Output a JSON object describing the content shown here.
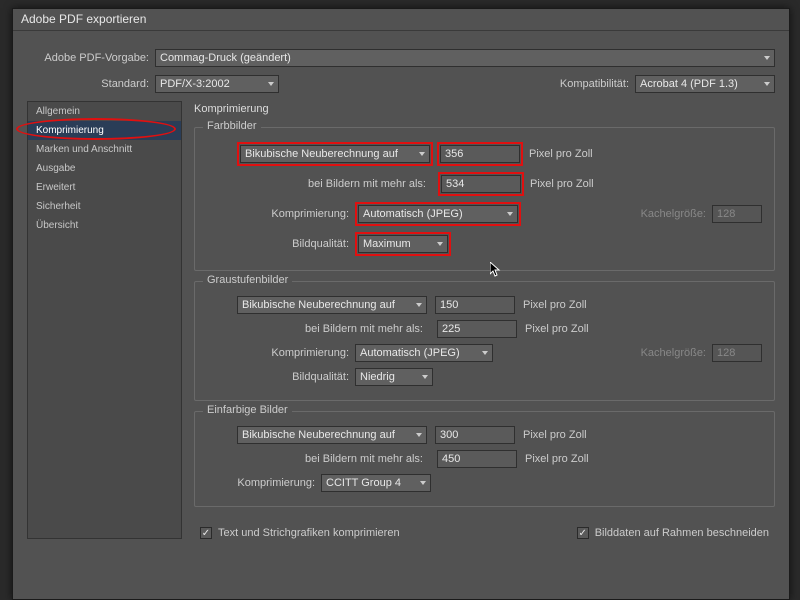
{
  "dialog": {
    "title": "Adobe PDF exportieren",
    "preset_label": "Adobe PDF-Vorgabe:",
    "preset_value": "Commag-Druck (geändert)",
    "standard_label": "Standard:",
    "standard_value": "PDF/X-3:2002",
    "compat_label": "Kompatibilität:",
    "compat_value": "Acrobat 4 (PDF 1.3)"
  },
  "sidebar": {
    "items": [
      {
        "label": "Allgemein"
      },
      {
        "label": "Komprimierung"
      },
      {
        "label": "Marken und Anschnitt"
      },
      {
        "label": "Ausgabe"
      },
      {
        "label": "Erweitert"
      },
      {
        "label": "Sicherheit"
      },
      {
        "label": "Übersicht"
      }
    ]
  },
  "panel": {
    "title": "Komprimierung",
    "groups": {
      "color": {
        "legend": "Farbbilder",
        "resample_label": "Bikubische Neuberechnung auf",
        "ppi": "356",
        "threshold_label": "bei Bildern mit mehr als:",
        "threshold": "534",
        "unit": "Pixel pro Zoll",
        "compr_label": "Komprimierung:",
        "compr_value": "Automatisch (JPEG)",
        "qual_label": "Bildqualität:",
        "qual_value": "Maximum",
        "tile_label": "Kachelgröße:",
        "tile_value": "128"
      },
      "gray": {
        "legend": "Graustufenbilder",
        "resample_label": "Bikubische Neuberechnung auf",
        "ppi": "150",
        "threshold_label": "bei Bildern mit mehr als:",
        "threshold": "225",
        "unit": "Pixel pro Zoll",
        "compr_label": "Komprimierung:",
        "compr_value": "Automatisch (JPEG)",
        "qual_label": "Bildqualität:",
        "qual_value": "Niedrig",
        "tile_label": "Kachelgröße:",
        "tile_value": "128"
      },
      "mono": {
        "legend": "Einfarbige Bilder",
        "resample_label": "Bikubische Neuberechnung auf",
        "ppi": "300",
        "threshold_label": "bei Bildern mit mehr als:",
        "threshold": "450",
        "unit": "Pixel pro Zoll",
        "compr_label": "Komprimierung:",
        "compr_value": "CCITT Group 4"
      }
    },
    "checks": {
      "text_compress": "Text und Strichgrafiken komprimieren",
      "crop_frame": "Bilddaten auf Rahmen beschneiden"
    }
  }
}
